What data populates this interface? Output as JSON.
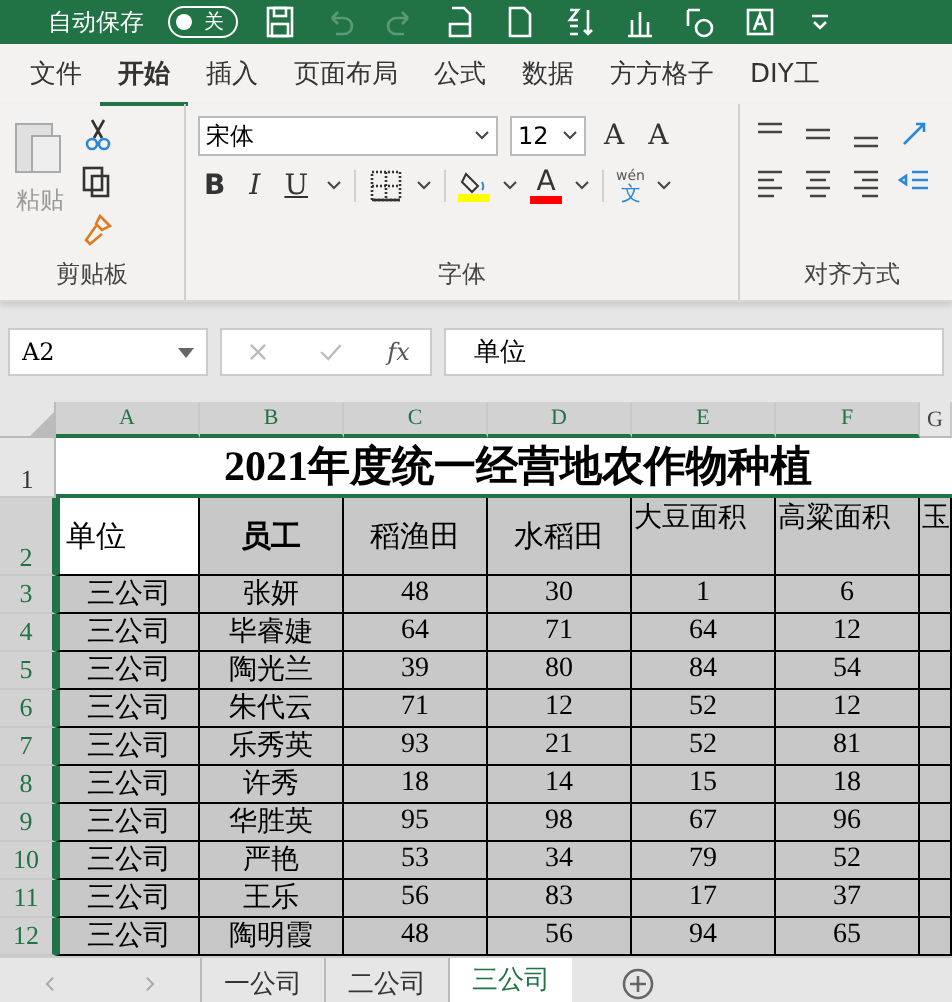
{
  "title_bar": {
    "autosave_label": "自动保存",
    "autosave_toggle": {
      "label": "关",
      "on": false
    }
  },
  "ribbon_tabs": [
    {
      "label": "文件",
      "selected": false
    },
    {
      "label": "开始",
      "selected": true
    },
    {
      "label": "插入",
      "selected": false
    },
    {
      "label": "页面布局",
      "selected": false
    },
    {
      "label": "公式",
      "selected": false
    },
    {
      "label": "数据",
      "selected": false
    },
    {
      "label": "方方格子",
      "selected": false
    },
    {
      "label": "DIY工",
      "selected": false
    }
  ],
  "ribbon": {
    "clipboard": {
      "paste_label": "粘贴",
      "group_label": "剪贴板"
    },
    "font": {
      "font_name": "宋体",
      "font_size": "12",
      "grow_label": "A",
      "shrink_label": "A",
      "style_buttons": [
        "B",
        "I",
        "U"
      ],
      "font_color_label": "A",
      "phonetic_top": "wén",
      "phonetic_label": "文",
      "group_label": "字体"
    },
    "alignment": {
      "group_label": "对齐方式"
    }
  },
  "formula_bar": {
    "name_box": "A2",
    "fx_label": "fx",
    "value": "单位"
  },
  "sheet": {
    "columns": [
      {
        "label": "A",
        "selected": true
      },
      {
        "label": "B",
        "selected": true
      },
      {
        "label": "C",
        "selected": true
      },
      {
        "label": "D",
        "selected": true
      },
      {
        "label": "E",
        "selected": true
      },
      {
        "label": "F",
        "selected": true
      },
      {
        "label": "G",
        "selected": false
      }
    ],
    "title_row": {
      "number": "1",
      "selected": false,
      "text": "2021年度统一经营地农作物种植"
    },
    "header_row": {
      "number": "2",
      "selected": true,
      "cells": [
        {
          "text": "单位",
          "bold": false,
          "active": true
        },
        {
          "text": "员工",
          "bold": true,
          "active": false
        },
        {
          "text": "稻渔田",
          "bold": false,
          "active": false
        },
        {
          "text": "水稻田",
          "bold": false,
          "active": false
        },
        {
          "text": "大豆面积",
          "bold": false,
          "active": false
        },
        {
          "text": "高粱面积",
          "bold": false,
          "active": false
        },
        {
          "text": "玉",
          "bold": false,
          "active": false
        }
      ]
    },
    "rows": [
      {
        "number": "3",
        "selected": true,
        "cells": [
          "三公司",
          "张妍",
          "48",
          "30",
          "1",
          "6"
        ]
      },
      {
        "number": "4",
        "selected": true,
        "cells": [
          "三公司",
          "毕睿婕",
          "64",
          "71",
          "64",
          "12"
        ]
      },
      {
        "number": "5",
        "selected": true,
        "cells": [
          "三公司",
          "陶光兰",
          "39",
          "80",
          "84",
          "54"
        ]
      },
      {
        "number": "6",
        "selected": true,
        "cells": [
          "三公司",
          "朱代云",
          "71",
          "12",
          "52",
          "12"
        ]
      },
      {
        "number": "7",
        "selected": true,
        "cells": [
          "三公司",
          "乐秀英",
          "93",
          "21",
          "52",
          "81"
        ]
      },
      {
        "number": "8",
        "selected": true,
        "cells": [
          "三公司",
          "许秀",
          "18",
          "14",
          "15",
          "18"
        ]
      },
      {
        "number": "9",
        "selected": true,
        "cells": [
          "三公司",
          "华胜英",
          "95",
          "98",
          "67",
          "96"
        ]
      },
      {
        "number": "10",
        "selected": true,
        "cells": [
          "三公司",
          "严艳",
          "53",
          "34",
          "79",
          "52"
        ]
      },
      {
        "number": "11",
        "selected": true,
        "cells": [
          "三公司",
          "王乐",
          "56",
          "83",
          "17",
          "37"
        ]
      },
      {
        "number": "12",
        "selected": true,
        "cells": [
          "三公司",
          "陶明霞",
          "48",
          "56",
          "94",
          "65"
        ]
      }
    ]
  },
  "sheet_tabs": [
    {
      "label": "一公司",
      "selected": false
    },
    {
      "label": "二公司",
      "selected": false
    },
    {
      "label": "三公司",
      "selected": true
    }
  ]
}
